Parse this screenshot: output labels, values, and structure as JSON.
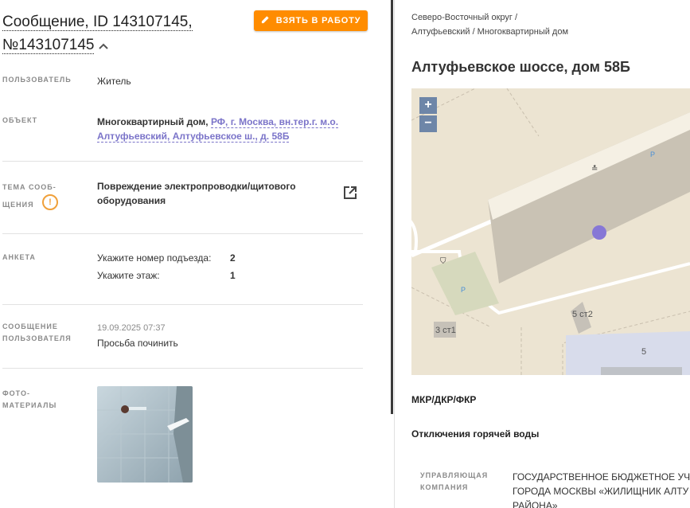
{
  "message": {
    "title_line1": "Сообщение, ID 143107145,",
    "title_line2": "№143107145",
    "take_button_label": "ВЗЯТЬ В РАБОТУ"
  },
  "fields": {
    "user": {
      "label": "ПОЛЬЗОВАТЕЛЬ",
      "value": "Житель"
    },
    "object": {
      "label": "ОБЪЕКТ",
      "type": "Многоквартирный дом,",
      "address_link_line1": "РФ, г. Москва, вн.тер.г. м.о.",
      "address_link_line2": "Алтуфьевский, Алтуфьевское ш., д. 58Б"
    },
    "topic": {
      "label_line1": "ТЕМА СООБ-",
      "label_line2": "ЩЕНИЯ",
      "value_line1": "Повреждение электропроводки/щитового",
      "value_line2": "оборудования"
    },
    "survey": {
      "label": "АНКЕТА",
      "rows": [
        {
          "question": "Укажите номер подъезда:",
          "answer": "2"
        },
        {
          "question": "Укажите этаж:",
          "answer": "1"
        }
      ]
    },
    "user_message": {
      "label_line1": "СООБЩЕНИЕ",
      "label_line2": "ПОЛЬЗОВАТЕЛЯ",
      "datetime": "19.09.2025 07:37",
      "text": "Просьба починить"
    },
    "photos": {
      "label_line1": "ФОТО-",
      "label_line2": "МАТЕРИАЛЫ"
    }
  },
  "right_panel": {
    "breadcrumb_line1": "Северо-Восточный округ /",
    "breadcrumb_line2": "Алтуфьевский / Многоквартирный дом",
    "address_title": "Алтуфьевское шоссе, дом 58Б",
    "map": {
      "zoom_in": "+",
      "zoom_out": "−",
      "labels": {
        "b1": "3 ст1",
        "b2": "5 ст2",
        "b3": "5",
        "p1": "P",
        "p2": "P"
      }
    },
    "section1": "МКР/ДКР/ФКР",
    "section2": "Отключения горячей воды",
    "mgmt": {
      "label_line1": "УПРАВЛЯЮЩАЯ",
      "label_line2": "КОМПАНИЯ",
      "value_line1": "ГОСУДАРСТВЕННОЕ БЮДЖЕТНОЕ УЧР",
      "value_line2": "ГОРОДА МОСКВЫ «ЖИЛИЩНИК АЛТУ",
      "value_line3": "РАЙОНА»"
    }
  },
  "colors": {
    "accent_orange": "#ff8c00",
    "link_purple": "#7b74c9",
    "warning": "#f0a03a",
    "map_marker": "#8677d6"
  },
  "icons": [
    "pencil-icon",
    "chevron-up-icon",
    "warning-icon",
    "external-link-icon"
  ]
}
